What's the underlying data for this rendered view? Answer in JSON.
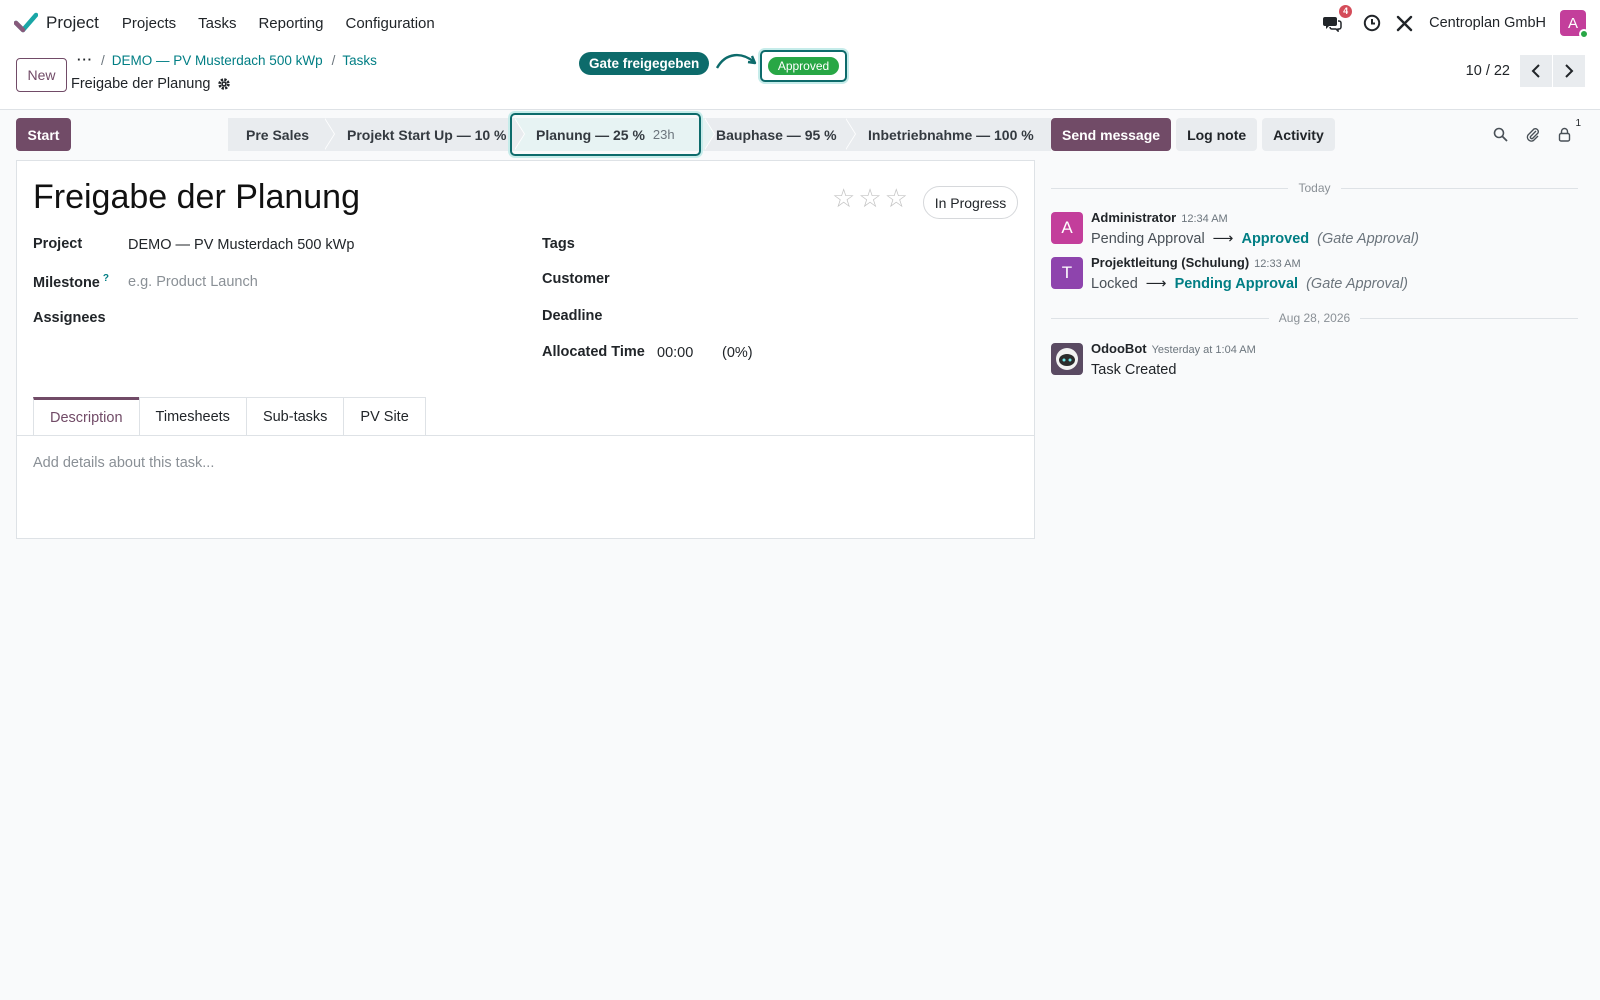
{
  "app": {
    "name": "Project",
    "menu": [
      "Projects",
      "Tasks",
      "Reporting",
      "Configuration"
    ],
    "message_count": "4",
    "company": "Centroplan GmbH",
    "user_initial": "A"
  },
  "control": {
    "new_label": "New",
    "more_label": "···",
    "breadcrumb": [
      "DEMO — PV Musterdach 500 kWp",
      "Tasks"
    ],
    "record_title": "Freigabe der Planung",
    "pager": "10 / 22"
  },
  "annotation": {
    "callout": "Gate freigegeben",
    "badge": "Approved"
  },
  "form": {
    "start_label": "Start",
    "stages": [
      {
        "label": "Pre Sales"
      },
      {
        "label": "Projekt Start Up — 10 %"
      },
      {
        "label": "Planung — 25 %",
        "duration": "23h",
        "active": true
      },
      {
        "label": "Bauphase — 95 %"
      },
      {
        "label": "Inbetriebnahme — 100 %"
      }
    ],
    "title": "Freigabe der Planung",
    "state": "In Progress",
    "priority_stars": 0,
    "fields": {
      "project_label": "Project",
      "project_value": "DEMO — PV Musterdach 500 kWp",
      "milestone_label": "Milestone",
      "milestone_help": "?",
      "milestone_placeholder": "e.g. Product Launch",
      "assignees_label": "Assignees",
      "tags_label": "Tags",
      "customer_label": "Customer",
      "deadline_label": "Deadline",
      "allocated_label": "Allocated Time",
      "allocated_value": "00:00",
      "allocated_pct": "(0%)"
    },
    "tabs": [
      "Description",
      "Timesheets",
      "Sub-tasks",
      "PV Site"
    ],
    "description_placeholder": "Add details about this task..."
  },
  "chatter": {
    "send_message": "Send message",
    "log_note": "Log note",
    "activity": "Activity",
    "followers": "1",
    "date_today": "Today",
    "date_older": "Aug 28, 2026",
    "messages": [
      {
        "initial": "A",
        "author": "Administrator",
        "time": "12:34 AM",
        "old": "Pending Approval",
        "arrow": "⟶",
        "new": "Approved",
        "field": "(Gate Approval)",
        "color": "#c33e9b"
      },
      {
        "initial": "T",
        "author": "Projektleitung (Schulung)",
        "time": "12:33 AM",
        "old": "Locked",
        "arrow": "⟶",
        "new": "Pending Approval",
        "field": "(Gate Approval)",
        "color": "#8e44ad"
      },
      {
        "author": "OdooBot",
        "time": "Yesterday at 1:04 AM",
        "text": "Task Created"
      }
    ]
  },
  "colors": {
    "primary": "#714b67",
    "link": "#017e84",
    "highlight": "#0d6b6b",
    "approved": "#28a745"
  }
}
